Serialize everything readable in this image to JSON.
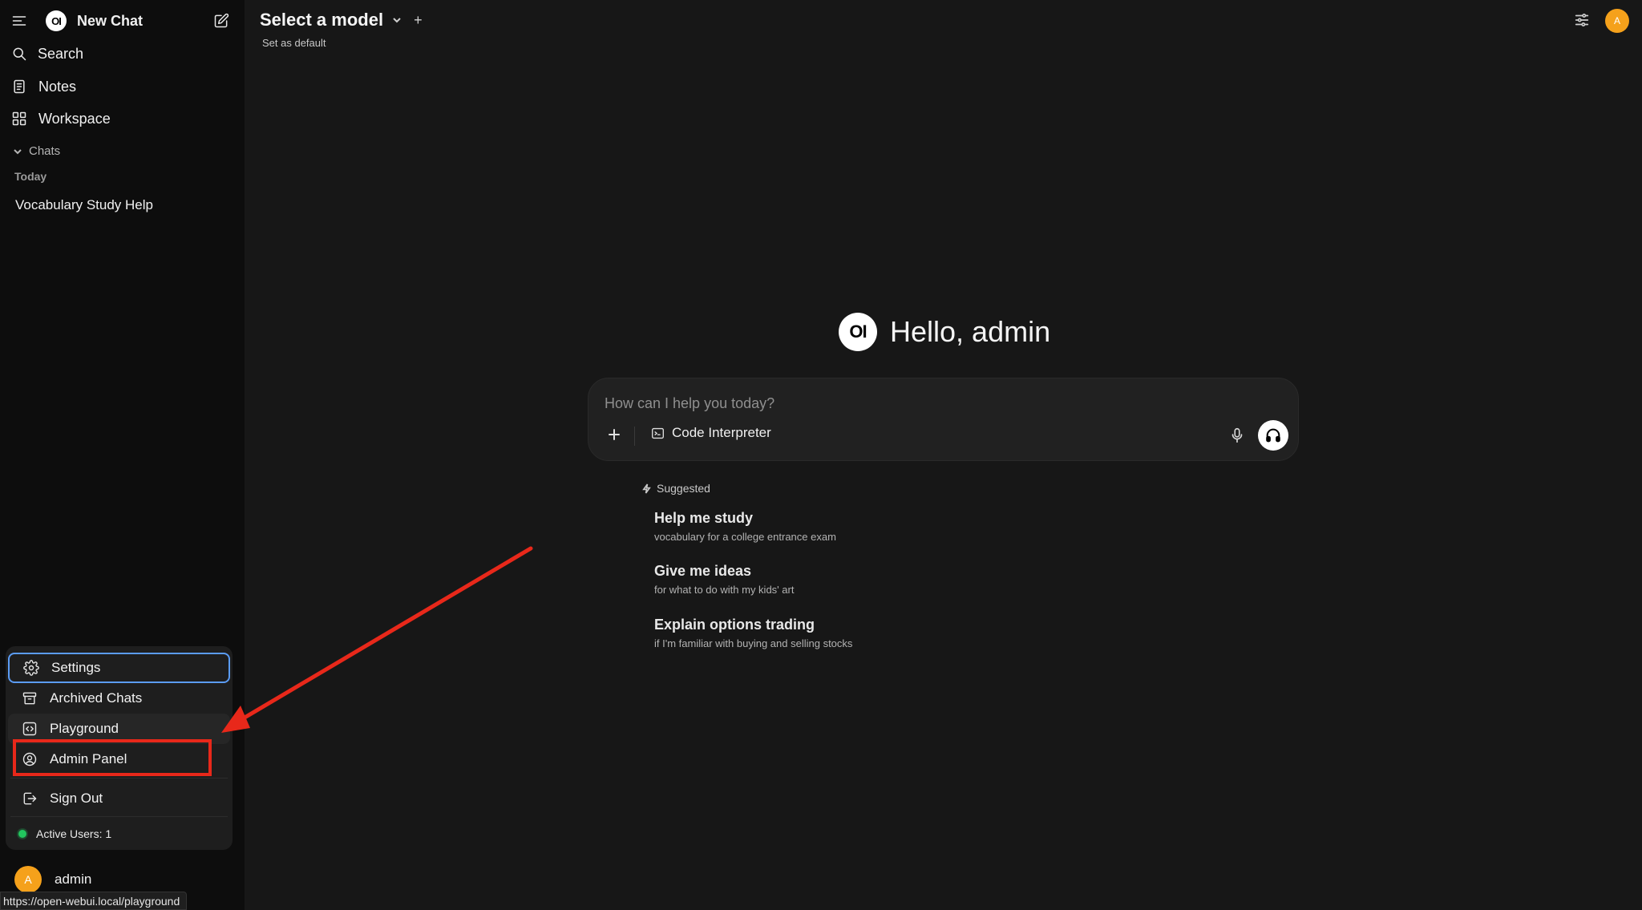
{
  "sidebar": {
    "new_chat_label": "New Chat",
    "logo_text": "OI",
    "nav": {
      "search": "Search",
      "notes": "Notes",
      "workspace": "Workspace"
    },
    "chats_header": "Chats",
    "today_label": "Today",
    "chat_items": [
      "Vocabulary Study Help"
    ],
    "user_menu": {
      "settings": "Settings",
      "archived_chats": "Archived Chats",
      "playground": "Playground",
      "admin_panel": "Admin Panel",
      "sign_out": "Sign Out",
      "active_users": "Active Users: 1"
    },
    "user": {
      "initial": "A",
      "name": "admin"
    }
  },
  "header": {
    "model_select": "Select a model",
    "plus": "+",
    "set_default": "Set as default",
    "avatar_initial": "A"
  },
  "main": {
    "logo_text": "OI",
    "greeting": "Hello, admin",
    "composer": {
      "placeholder": "How can I help you today?",
      "code_interpreter": "Code Interpreter"
    },
    "suggested_label": "Suggested",
    "suggestions": [
      {
        "title": "Help me study",
        "subtitle": "vocabulary for a college entrance exam"
      },
      {
        "title": "Give me ideas",
        "subtitle": "for what to do with my kids' art"
      },
      {
        "title": "Explain options trading",
        "subtitle": "if I'm familiar with buying and selling stocks"
      }
    ]
  },
  "status_bar": {
    "url": "https://open-webui.local/playground"
  },
  "colors": {
    "background": "#171717",
    "sidebar": "#0d0d0d",
    "menu": "#1e1e1e",
    "focus_ring": "#5b9cf5",
    "annotation_red": "#e8281a",
    "avatar": "#f5a11b",
    "online": "#22c55e"
  }
}
